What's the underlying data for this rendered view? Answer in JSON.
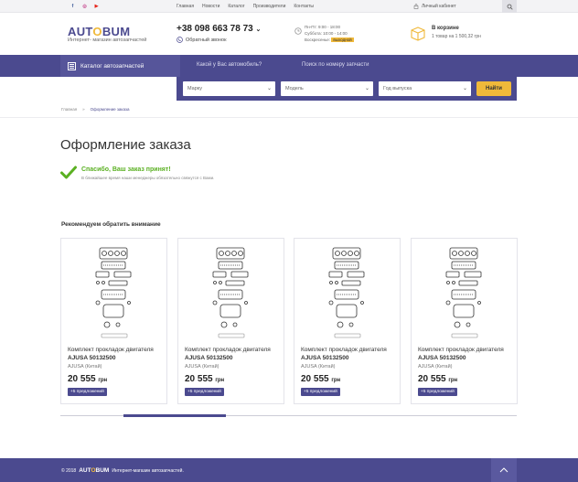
{
  "topbar": {
    "social": [
      {
        "icon": "facebook-icon",
        "glyph": "f",
        "color": "#3b5998"
      },
      {
        "icon": "instagram-icon",
        "glyph": "◎",
        "color": "#c13584"
      },
      {
        "icon": "youtube-icon",
        "glyph": "▶",
        "color": "#e62117"
      }
    ],
    "menu": [
      "Главная",
      "Новости",
      "Каталог",
      "Производители",
      "Контакты"
    ],
    "cabinet_label": "Личный кабинет"
  },
  "header": {
    "logo_pre": "AUT",
    "logo_o": "O",
    "logo_post": "BUM",
    "logo_sub": "Интернет- магазин автозапчастей",
    "phone": "+38 098 663 78 73",
    "callback": "Обратный звонок",
    "hours": {
      "weekdays": "Пн-Пт: 9:00 - 18:00",
      "saturday": "Суббота: 10:00 - 14:00",
      "sunday_label": "Воскресенье:",
      "sunday_value": "выходной"
    },
    "cart_title": "В корзине",
    "cart_sub": "1 товар на 1 500,32 грн"
  },
  "nav": {
    "catalog": "Каталог автозапчастей",
    "tab_car": "Какой у Вас автомобиль?",
    "tab_number": "Поиск по номеру запчасти"
  },
  "filter": {
    "brand": "Марку",
    "model": "Модель",
    "year": "Год выпуска",
    "submit": "Найти"
  },
  "breadcrumbs": {
    "home": "Главная",
    "sep": "»",
    "current": "Оформление заказа"
  },
  "page": {
    "title": "Оформление заказа",
    "success": "Спасибо, Ваш заказ принят!",
    "success_sub": "В ближайшее время наши менеджеры обязательно свяжутся с Вами."
  },
  "recommend": {
    "title": "Рекомендуем обратить внимание",
    "products": [
      {
        "name": "Комплект прокладок двигателя",
        "code": "AJUSA 50132500",
        "brand": "AJUSA  (Китай)",
        "price": "20 555",
        "currency": "грн",
        "offers": "+5 предложений"
      },
      {
        "name": "Комплект прокладок двигателя",
        "code": "AJUSA 50132500",
        "brand": "AJUSA  (Китай)",
        "price": "20 555",
        "currency": "грн",
        "offers": "+5 предложений"
      },
      {
        "name": "Комплект прокладок двигателя",
        "code": "AJUSA 50132500",
        "brand": "AJUSA  (Китай)",
        "price": "20 555",
        "currency": "грн",
        "offers": "+5 предложений"
      },
      {
        "name": "Комплект прокладок двигателя",
        "code": "AJUSA 50132500",
        "brand": "AJUSA  (Китай)",
        "price": "20 555",
        "currency": "грн",
        "offers": "+5 предложений"
      }
    ]
  },
  "footer": {
    "copyright": "© 2018",
    "logo_pre": "AUT",
    "logo_o": "O",
    "logo_post": "BUM",
    "text": "Интернет-магазин автозапчастей."
  },
  "colors": {
    "brand": "#4b4a8f",
    "accent": "#f0b93a",
    "success": "#5ab022"
  }
}
